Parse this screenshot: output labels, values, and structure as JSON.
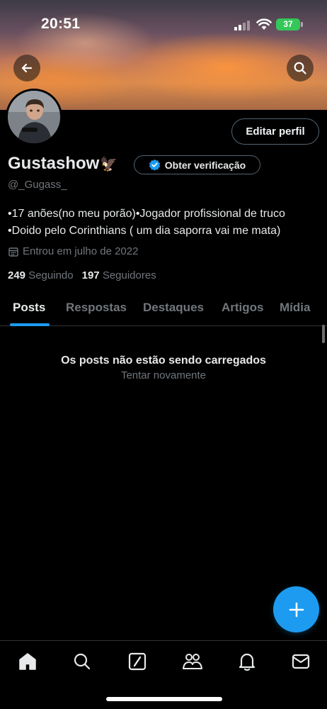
{
  "status_bar": {
    "time": "20:51",
    "battery": "37"
  },
  "header": {
    "back_icon": "arrow-left-icon",
    "search_icon": "search-icon"
  },
  "profile": {
    "edit_label": "Editar perfil",
    "name": "Gustashow",
    "name_emoji": "🦅",
    "verify_label": "Obter verificação",
    "handle": "@_Gugass_",
    "bio_line1": "•17 anões(no meu porão)•Jogador profissional de truco",
    "bio_line2": "•Doido pelo Corinthians ( um dia saporra vai me mata)",
    "joined": "Entrou em julho de 2022",
    "following_count": "249",
    "following_label": "Seguindo",
    "followers_count": "197",
    "followers_label": "Seguidores"
  },
  "tabs": [
    {
      "label": "Posts",
      "active": true
    },
    {
      "label": "Respostas"
    },
    {
      "label": "Destaques"
    },
    {
      "label": "Artigos"
    },
    {
      "label": "Mídia"
    }
  ],
  "empty_state": {
    "title": "Os posts não estão sendo carregados",
    "retry": "Tentar novamente"
  },
  "colors": {
    "accent": "#1d9bf0",
    "background": "#000000",
    "secondary_text": "#71767b"
  },
  "bottom_nav": [
    "home-icon",
    "search-icon",
    "grok-icon",
    "communities-icon",
    "notifications-icon",
    "messages-icon"
  ]
}
